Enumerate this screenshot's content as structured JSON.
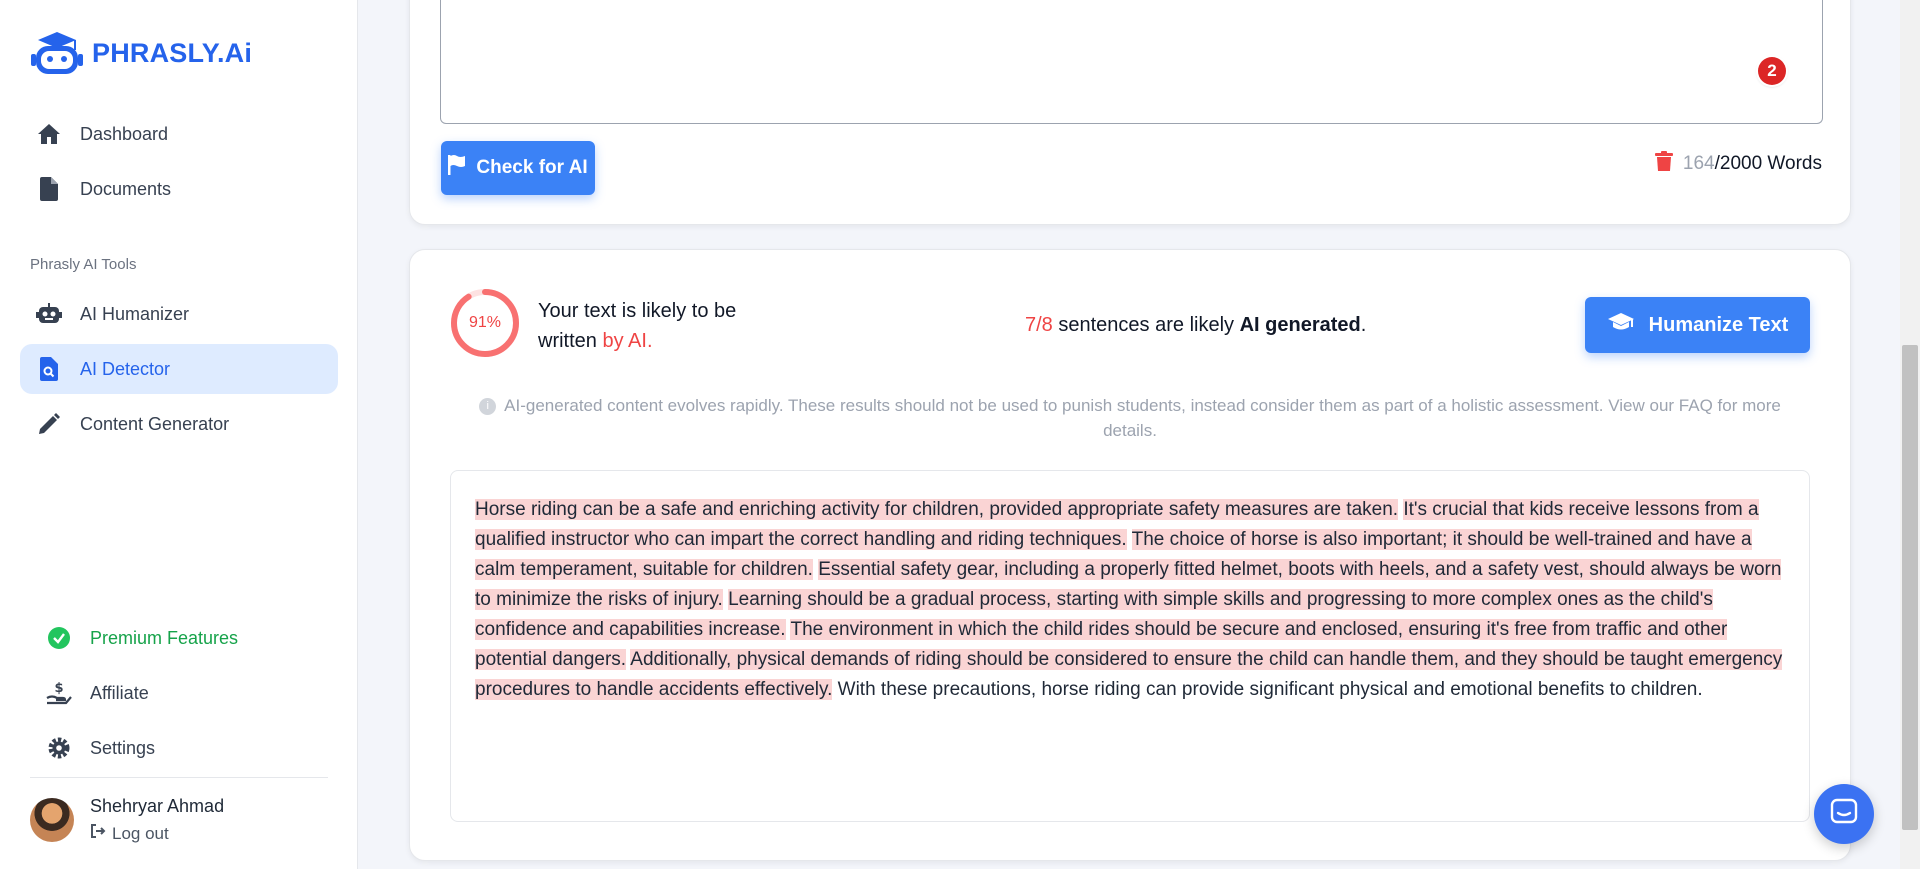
{
  "brand": {
    "name": "PHRASLY.Ai",
    "color": "#2563eb"
  },
  "sidebar": {
    "items": [
      {
        "label": "Dashboard",
        "icon": "home-icon"
      },
      {
        "label": "Documents",
        "icon": "document-icon"
      }
    ],
    "section_label": "Phrasly AI Tools",
    "tools": [
      {
        "label": "AI Humanizer",
        "icon": "robot-icon"
      },
      {
        "label": "AI Detector",
        "icon": "detector-icon",
        "active": true
      },
      {
        "label": "Content Generator",
        "icon": "pencil-icon"
      }
    ],
    "bottom": [
      {
        "label": "Premium Features",
        "icon": "check-circle-icon"
      },
      {
        "label": "Affiliate",
        "icon": "hand-dollar-icon"
      },
      {
        "label": "Settings",
        "icon": "gear-icon"
      }
    ],
    "user": {
      "name": "Shehryar Ahmad",
      "logout": "Log out"
    }
  },
  "editor": {
    "notification_count": "2",
    "check_button": "Check for AI",
    "word_count": "164",
    "word_limit": "/2000 Words"
  },
  "result": {
    "percent": "91%",
    "percent_value": 0.91,
    "likely_line1": "Your text is likely to be",
    "likely_line2": "written",
    "likely_red": "by AI.",
    "sentences_ratio": "7/8",
    "sentences_text": "sentences are likely",
    "sentences_bold": "AI generated",
    "sentences_end": ".",
    "humanize_button": "Humanize Text",
    "disclaimer": "AI-generated content evolves rapidly. These results should not be used to punish students, instead consider them as part of a holistic assessment. View our FAQ for more details.",
    "sentences": [
      {
        "text": "Horse riding can be a safe and enriching activity for children, provided appropriate safety measures are taken.",
        "ai": true
      },
      {
        "text": "It's crucial that kids receive lessons from a qualified instructor who can impart the correct handling and riding techniques.",
        "ai": true
      },
      {
        "text": "The choice of horse is also important; it should be well-trained and have a calm temperament, suitable for children.",
        "ai": true
      },
      {
        "text": "Essential safety gear, including a properly fitted helmet, boots with heels, and a safety vest, should always be worn to minimize the risks of injury.",
        "ai": true
      },
      {
        "text": "Learning should be a gradual process, starting with simple skills and progressing to more complex ones as the child's confidence and capabilities increase.",
        "ai": true
      },
      {
        "text": "The environment in which the child rides should be secure and enclosed, ensuring it's free from traffic and other potential dangers.",
        "ai": true
      },
      {
        "text": "Additionally, physical demands of riding should be considered to ensure the child can handle them, and they should be taught emergency procedures to handle accidents effectively.",
        "ai": true
      },
      {
        "text": "With these precautions, horse riding can provide significant physical and emotional benefits to children.",
        "ai": false
      }
    ],
    "highlight_color": "#fad4d4",
    "accent_red": "#ef4444"
  }
}
